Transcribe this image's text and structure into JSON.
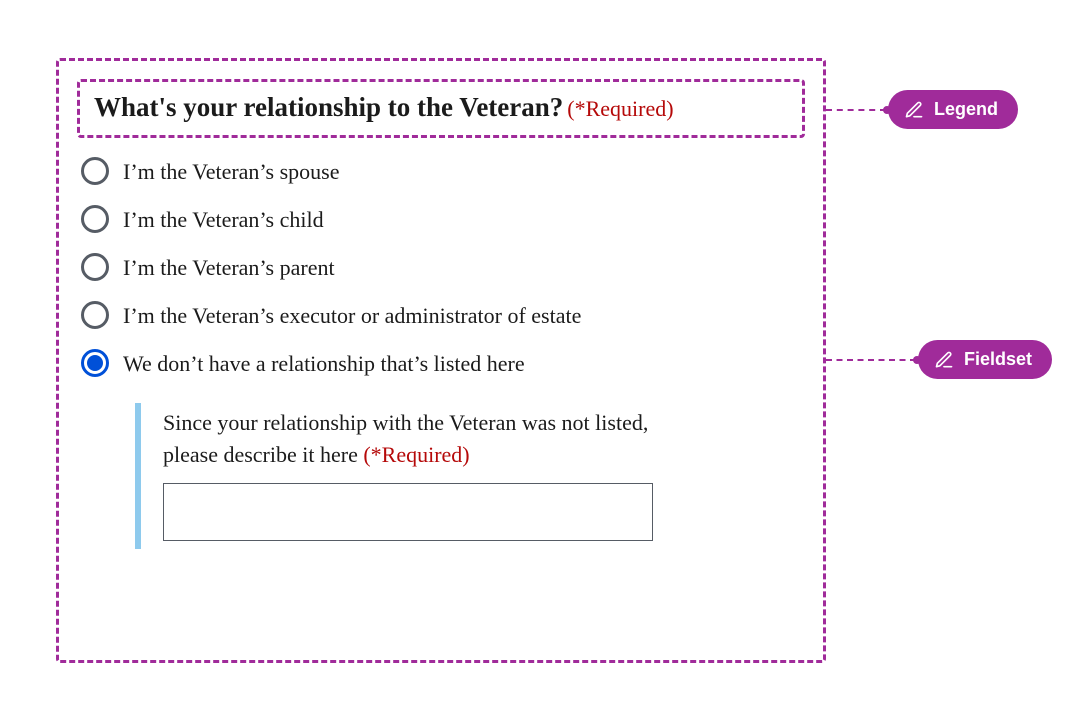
{
  "legend": {
    "question": "What's your relationship to the Veteran?",
    "required": "(*Required)"
  },
  "options": [
    {
      "label": "I’m the Veteran’s spouse",
      "selected": false
    },
    {
      "label": "I’m the Veteran’s child",
      "selected": false
    },
    {
      "label": "I’m the Veteran’s parent",
      "selected": false
    },
    {
      "label": "I’m the Veteran’s executor or administrator of estate",
      "selected": false
    },
    {
      "label": "We don’t have a relationship that’s listed here",
      "selected": true
    }
  ],
  "conditional": {
    "prompt": "Since your relationship with the Veteran was not listed, please describe it here",
    "required": "(*Required)",
    "value": ""
  },
  "callouts": {
    "legend": "Legend",
    "fieldset": "Fieldset"
  }
}
